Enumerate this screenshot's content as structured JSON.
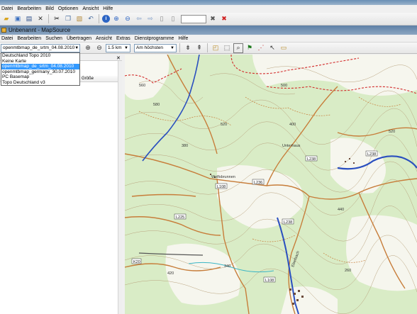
{
  "outer_app": {
    "menu": [
      "Datei",
      "Bearbeiten",
      "Bild",
      "Optionen",
      "Ansicht",
      "Hilfe"
    ]
  },
  "inner_app": {
    "title": "Unbenannt - MapSource",
    "menu": [
      "Datei",
      "Bearbeiten",
      "Suchen",
      "Übertragen",
      "Ansicht",
      "Extras",
      "Dienstprogramme",
      "Hilfe"
    ]
  },
  "toolbar": {
    "map_product": "openmtbmap_de_srtm_04.08.2010",
    "scale": "1.5 km",
    "detail": "Am höchsten"
  },
  "dropdown": {
    "items": [
      "Deutschland Topo 2010",
      "Keine Karte",
      "openmtbmap_de_srtm_04.08.2010",
      "openmtbmap_germany_30.07.2010",
      "PC Basemap",
      "Topo Deutschland v3"
    ],
    "selected_index": 2
  },
  "left_panel": {
    "column_header": "Größe"
  },
  "map": {
    "road_labels": [
      "L238",
      "L238",
      "L236",
      "L238",
      "L225",
      "L108",
      "K20",
      "L108"
    ],
    "elevation_labels": [
      "520",
      "580",
      "400",
      "440",
      "520",
      "560",
      "420",
      "260",
      "380",
      "340",
      "500"
    ],
    "place_labels": [
      "Wolfsbrunnen",
      "Unterhaus",
      "Eberbach"
    ],
    "colors": {
      "forest": "#d7ebc3",
      "open": "#f6f6ee",
      "road": "#c77d3a",
      "border": "#d22a2a",
      "river": "#2a4fbf"
    }
  }
}
